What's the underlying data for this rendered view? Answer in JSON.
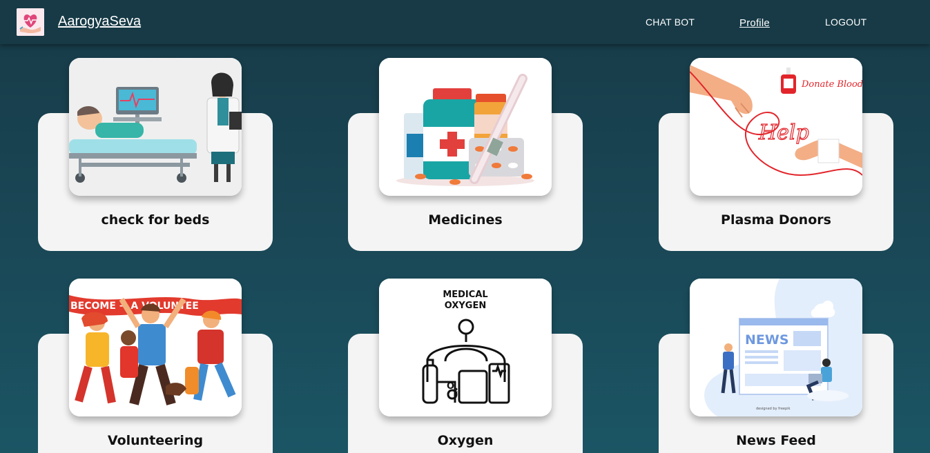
{
  "navbar": {
    "brand": "AarogyaSeva",
    "links": {
      "chatbot": "CHAT BOT",
      "profile": "Profile",
      "logout": "LOGOUT"
    }
  },
  "cards": [
    {
      "title": "check for beds",
      "image": "hospital-bed-illustration"
    },
    {
      "title": "Medicines",
      "image": "medicines-illustration"
    },
    {
      "title": "Plasma Donors",
      "image": "donate-blood-illustration",
      "image_text": [
        "Donate Blood",
        "Help"
      ]
    },
    {
      "title": "Volunteering",
      "image": "volunteers-illustration",
      "image_text": "BECOME A VOLUNTEE"
    },
    {
      "title": "Oxygen",
      "image": "medical-oxygen-illustration",
      "image_text": [
        "MEDICAL",
        "OXYGEN",
        "O2"
      ]
    },
    {
      "title": "News Feed",
      "image": "news-illustration",
      "image_text": [
        "NEWS",
        "designed by freepik"
      ]
    }
  ],
  "colors": {
    "background_top": "#173a47",
    "background_bottom": "#1b5564",
    "navbar": "#173a46",
    "card": "#f4f4f4"
  }
}
